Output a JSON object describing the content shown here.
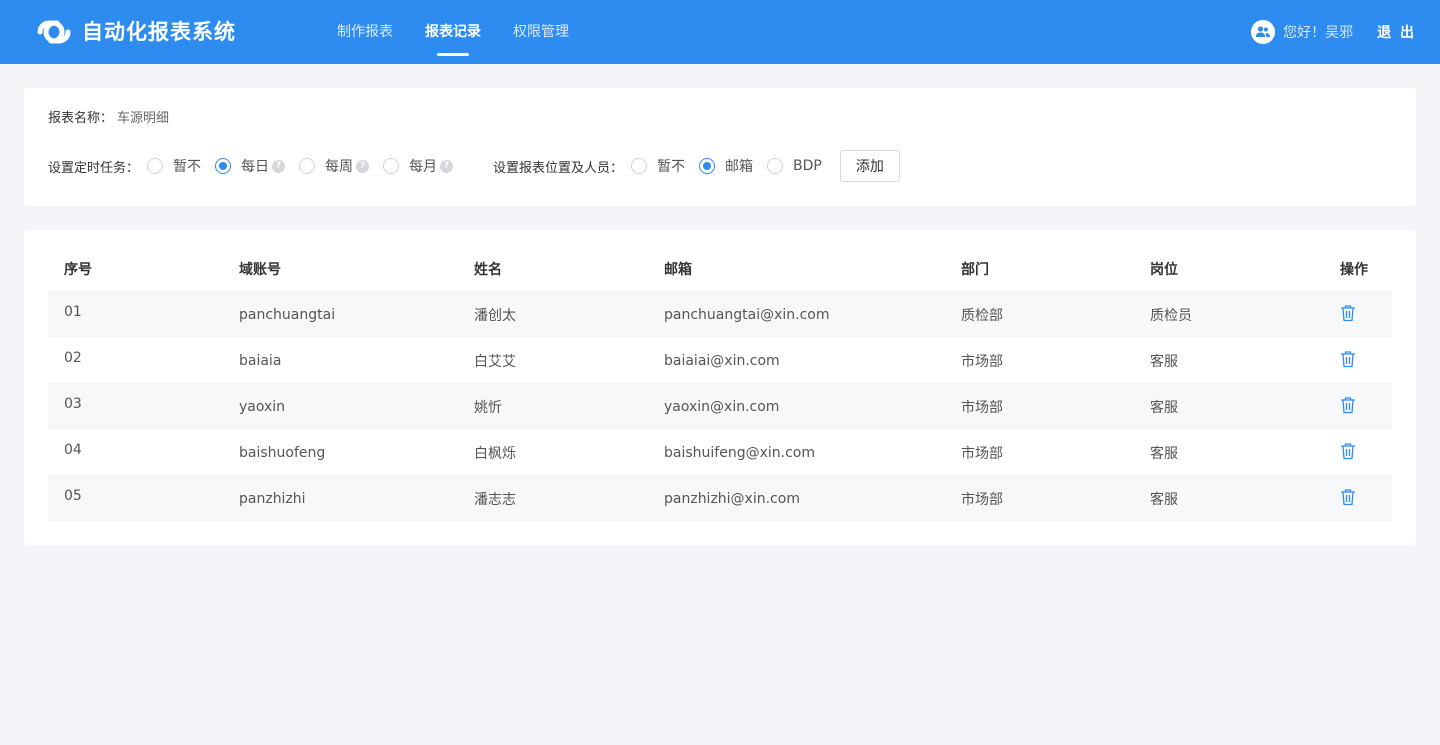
{
  "header": {
    "app_title": "自动化报表系统",
    "logo_icon": "link-logo-icon",
    "nav": [
      {
        "label": "制作报表",
        "active": false
      },
      {
        "label": "报表记录",
        "active": true
      },
      {
        "label": "权限管理",
        "active": false
      }
    ],
    "greeting": "您好！吴邪",
    "logout": "退 出",
    "avatar_icon": "user-group-icon"
  },
  "config": {
    "report_name_label": "报表名称：",
    "report_name_value": "车源明细",
    "schedule_label": "设置定时任务：",
    "schedule_options": [
      {
        "label": "暂不",
        "checked": false,
        "help": false
      },
      {
        "label": "每日",
        "checked": true,
        "help": true
      },
      {
        "label": "每周",
        "checked": false,
        "help": true
      },
      {
        "label": "每月",
        "checked": false,
        "help": true
      }
    ],
    "help_symbol": "?",
    "location_label": "设置报表位置及人员：",
    "location_options": [
      {
        "label": "暂不",
        "checked": false
      },
      {
        "label": "邮箱",
        "checked": true
      },
      {
        "label": "BDP",
        "checked": false
      }
    ],
    "add_button": "添加"
  },
  "table": {
    "columns": [
      "序号",
      "域账号",
      "姓名",
      "邮箱",
      "部门",
      "岗位",
      "操作"
    ],
    "rows": [
      {
        "index": "01",
        "account": "panchuangtai",
        "name": "潘创太",
        "email": "panchuangtai@xin.com",
        "dept": "质检部",
        "role": "质检员"
      },
      {
        "index": "02",
        "account": "baiaia",
        "name": "白艾艾",
        "email": "baiaiai@xin.com",
        "dept": "市场部",
        "role": "客服"
      },
      {
        "index": "03",
        "account": "yaoxin",
        "name": "姚忻",
        "email": "yaoxin@xin.com",
        "dept": "市场部",
        "role": "客服"
      },
      {
        "index": "04",
        "account": "baishuofeng",
        "name": "白枫烁",
        "email": "baishuifeng@xin.com",
        "dept": "市场部",
        "role": "客服"
      },
      {
        "index": "05",
        "account": "panzhizhi",
        "name": "潘志志",
        "email": "panzhizhi@xin.com",
        "dept": "市场部",
        "role": "客服"
      }
    ],
    "action_icon": "trash-icon"
  },
  "colors": {
    "brand": "#2e8cf0",
    "page_bg": "#f4f5f8",
    "stripe": "#f7f8fa"
  }
}
